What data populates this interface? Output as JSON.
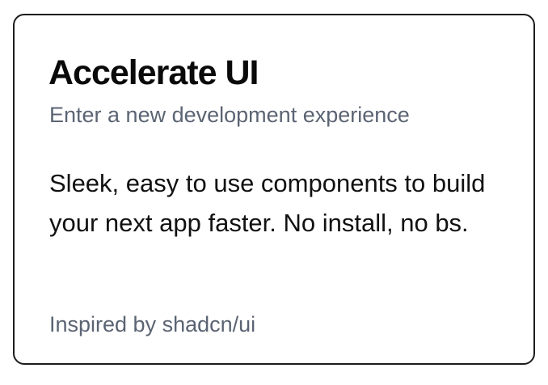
{
  "card": {
    "title": "Accelerate UI",
    "subtitle": "Enter a new development experience",
    "body": "Sleek, easy to use components to build your next app faster. No install, no bs.",
    "footer": "Inspired by shadcn/ui"
  },
  "colors": {
    "border": "#1d1d1f",
    "title": "#0a0a0a",
    "muted": "#5b6473",
    "body": "#111111",
    "background": "#ffffff"
  }
}
